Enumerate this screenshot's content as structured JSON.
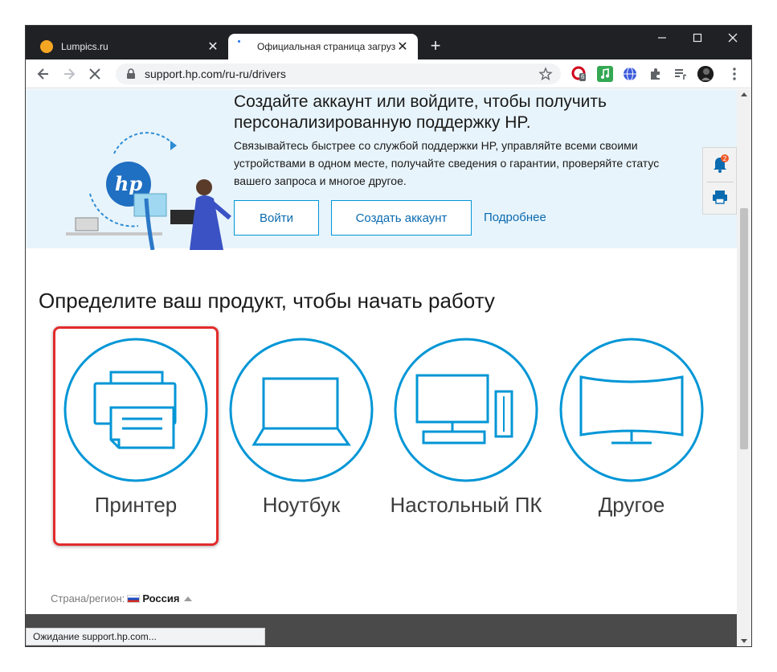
{
  "browser": {
    "tabs": [
      {
        "title": "Lumpics.ru",
        "active": false
      },
      {
        "title": "Официальная страница загрузк",
        "active": true
      }
    ],
    "url": "support.hp.com/ru-ru/drivers",
    "extension_badge": "6",
    "status_text": "Ожидание support.hp.com..."
  },
  "banner": {
    "title": "Создайте аккаунт или войдите, чтобы получить персонализированную поддержку HP.",
    "text": "Связывайтесь быстрее со службой поддержки HP, управляйте всеми своими устройствами в одном месте, получайте сведения о гарантии, проверяйте статус вашего запроса и многое другое.",
    "login_label": "Войти",
    "create_label": "Создать аккаунт",
    "more_label": "Подробнее",
    "logo_text": "hp"
  },
  "notifications": {
    "count": "2"
  },
  "products": {
    "title": "Определите ваш продукт, чтобы начать работу",
    "items": [
      {
        "label": "Принтер",
        "icon": "printer-icon"
      },
      {
        "label": "Ноутбук",
        "icon": "laptop-icon"
      },
      {
        "label": "Настольный ПК",
        "icon": "desktop-icon"
      },
      {
        "label": "Другое",
        "icon": "monitor-icon"
      }
    ]
  },
  "region": {
    "label": "Страна/регион:",
    "country": "Россия"
  },
  "colors": {
    "accent": "#0096d6",
    "highlight": "#e32b2b",
    "banner_bg": "#e8f4fb"
  }
}
